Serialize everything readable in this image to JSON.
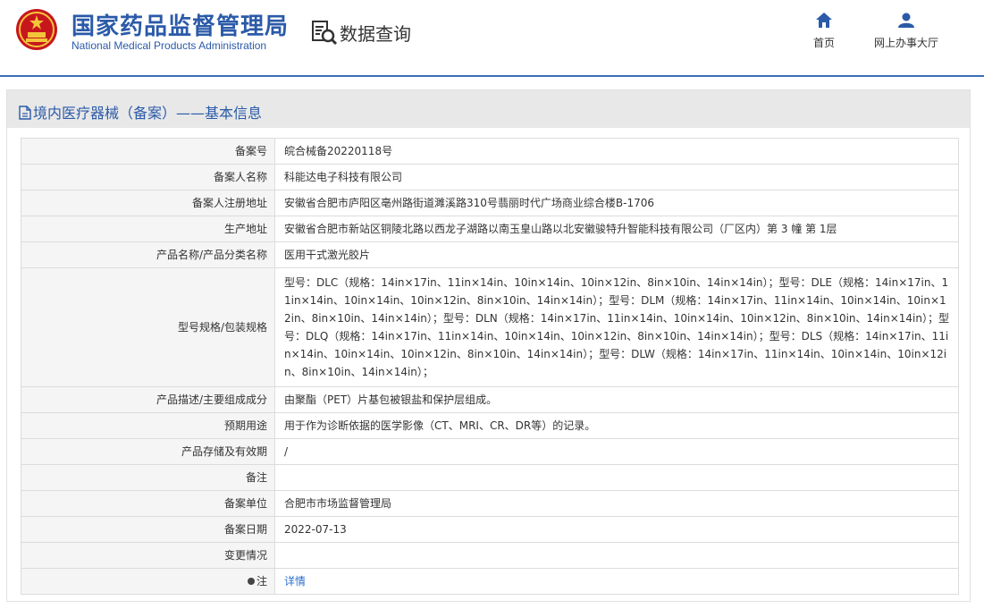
{
  "header": {
    "brand_cn": "国家药品监督管理局",
    "brand_en": "National Medical Products Administration",
    "section_title": "数据查询",
    "nav": [
      {
        "label": "首页",
        "icon": "home-icon"
      },
      {
        "label": "网上办事大厅",
        "icon": "user-icon"
      }
    ]
  },
  "panel": {
    "title": "境内医疗器械（备案）——基本信息"
  },
  "rows": [
    {
      "label": "备案号",
      "value": "皖合械备20220118号"
    },
    {
      "label": "备案人名称",
      "value": "科能达电子科技有限公司"
    },
    {
      "label": "备案人注册地址",
      "value": "安徽省合肥市庐阳区亳州路街道濉溪路310号翡丽时代广场商业综合楼B-1706"
    },
    {
      "label": "生产地址",
      "value": "安徽省合肥市新站区铜陵北路以西龙子湖路以南玉皇山路以北安徽骏特升智能科技有限公司（厂区内）第 3 幢 第 1层"
    },
    {
      "label": "产品名称/产品分类名称",
      "value": "医用干式激光胶片"
    },
    {
      "label": "型号规格/包装规格",
      "value": "型号：DLC（规格：14in×17in、11in×14in、10in×14in、10in×12in、8in×10in、14in×14in）；型号：DLE（规格：14in×17in、11in×14in、10in×14in、10in×12in、8in×10in、14in×14in）；型号：DLM（规格：14in×17in、11in×14in、10in×14in、10in×12in、8in×10in、14in×14in）；型号：DLN（规格：14in×17in、11in×14in、10in×14in、10in×12in、8in×10in、14in×14in）；型号：DLQ（规格：14in×17in、11in×14in、10in×14in、10in×12in、8in×10in、14in×14in）；型号：DLS（规格：14in×17in、11in×14in、10in×14in、10in×12in、8in×10in、14in×14in）；型号：DLW（规格：14in×17in、11in×14in、10in×14in、10in×12in、8in×10in、14in×14in）；"
    },
    {
      "label": "产品描述/主要组成成分",
      "value": "由聚酯（PET）片基包被银盐和保护层组成。"
    },
    {
      "label": "预期用途",
      "value": "用于作为诊断依据的医学影像（CT、MRI、CR、DR等）的记录。"
    },
    {
      "label": "产品存储及有效期",
      "value": "/"
    },
    {
      "label": "备注",
      "value": ""
    },
    {
      "label": "备案单位",
      "value": "合肥市市场监督管理局"
    },
    {
      "label": "备案日期",
      "value": "2022-07-13"
    },
    {
      "label": "变更情况",
      "value": ""
    }
  ],
  "note_row": {
    "label": "注",
    "link": "详情"
  },
  "colors": {
    "brand_blue": "#2b5aa8",
    "link_blue": "#2b6fcf",
    "label_bg": "#f5f5f5",
    "head_bg": "#e8e8e8"
  }
}
